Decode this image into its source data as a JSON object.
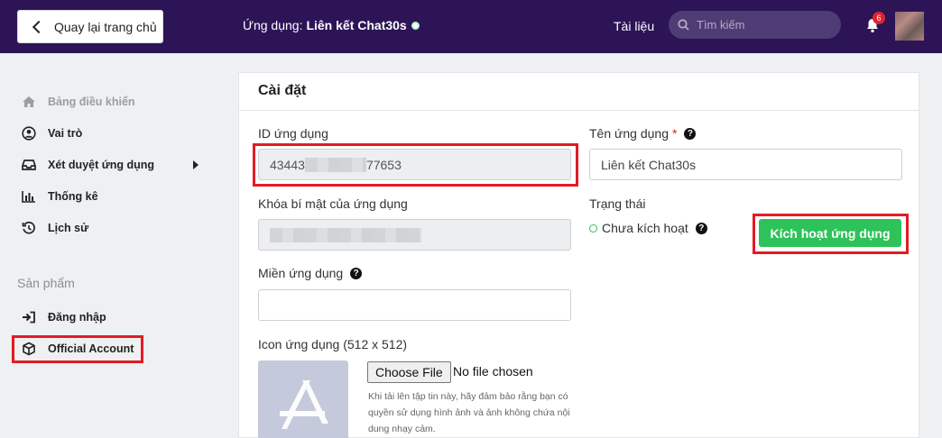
{
  "header": {
    "back_label": "Quay lại trang chủ",
    "app_prefix": "Ứng dụng:",
    "app_name": "Liên kết Chat30s",
    "docs_label": "Tài liệu",
    "search_placeholder": "Tìm kiếm",
    "notification_count": "6"
  },
  "sidebar": {
    "items": [
      {
        "label": "Bảng điều khiển",
        "icon": "home-icon"
      },
      {
        "label": "Vai trò",
        "icon": "user-circle-icon"
      },
      {
        "label": "Xét duyệt ứng dụng",
        "icon": "inbox-icon"
      },
      {
        "label": "Thống kê",
        "icon": "bar-chart-icon"
      },
      {
        "label": "Lịch sử",
        "icon": "history-icon"
      }
    ],
    "section_label": "Sản phẩm",
    "products": [
      {
        "label": "Đăng nhập",
        "icon": "sign-in-icon"
      },
      {
        "label": "Official Account",
        "icon": "cube-icon"
      }
    ]
  },
  "settings": {
    "title": "Cài đặt",
    "app_id_label": "ID ứng dụng",
    "app_id_prefix": "43443",
    "app_id_suffix": "77653",
    "app_name_label": "Tên ứng dụng",
    "app_name_value": "Liên kết Chat30s",
    "secret_label": "Khóa bí mật của ứng dụng",
    "status_label": "Trạng thái",
    "status_value": "Chưa kích hoạt",
    "activate_label": "Kích hoạt ứng dụng",
    "domain_label": "Miền ứng dụng",
    "icon_label": "Icon ứng dụng (512 x 512)",
    "choose_file_label": "Choose File",
    "no_file_label": "No file chosen",
    "upload_hint": "Khi tải lên tập tin này, hãy đảm bảo rằng bạn có quyền sử dụng hình ảnh và ảnh không chứa nội dung nhạy cảm."
  },
  "colors": {
    "header_bg": "#2d1457",
    "accent_green": "#2ec25a",
    "highlight_red": "#e31b23"
  }
}
